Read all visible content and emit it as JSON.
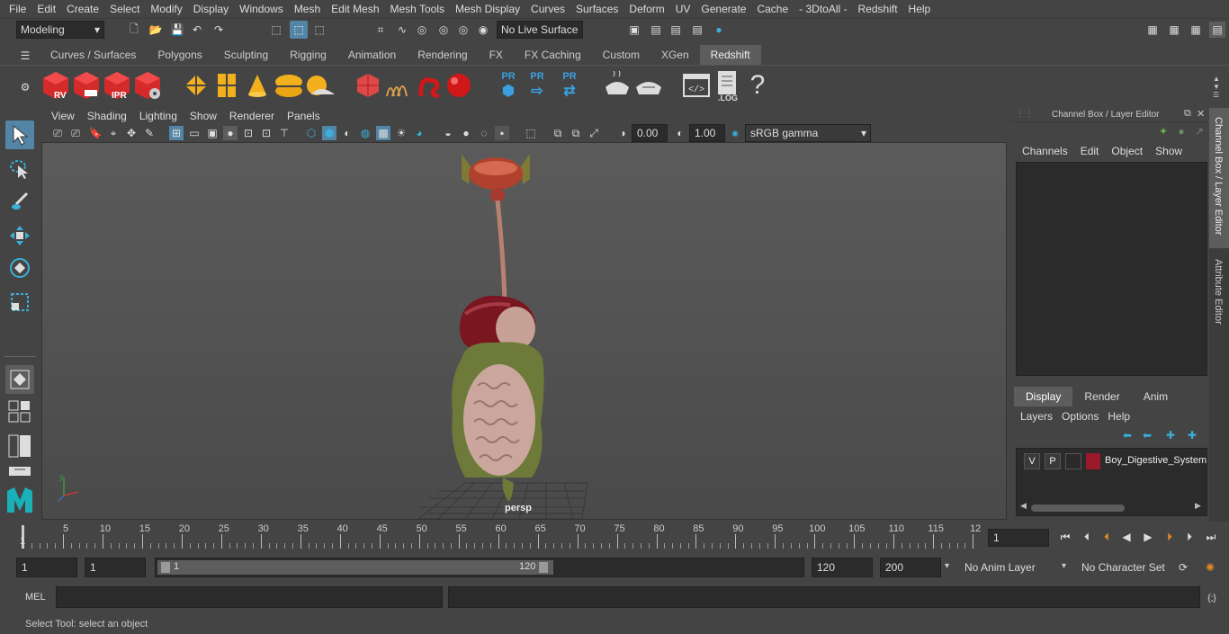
{
  "menu": [
    "File",
    "Edit",
    "Create",
    "Select",
    "Modify",
    "Display",
    "Windows",
    "Mesh",
    "Edit Mesh",
    "Mesh Tools",
    "Mesh Display",
    "Curves",
    "Surfaces",
    "Deform",
    "UV",
    "Generate",
    "Cache",
    "- 3DtoAll -",
    "Redshift",
    "Help"
  ],
  "status": {
    "mode": "Modeling",
    "live_surface": "No Live Surface"
  },
  "shelf_tabs": [
    "Curves / Surfaces",
    "Polygons",
    "Sculpting",
    "Rigging",
    "Animation",
    "Rendering",
    "FX",
    "FX Caching",
    "Custom",
    "XGen",
    "Redshift"
  ],
  "shelf_active": "Redshift",
  "shelf_icons": {
    "rv": "RV",
    "ipr": "IPR",
    "pr": "PR",
    "log": ".LOG",
    "question": "?"
  },
  "viewport": {
    "menu": [
      "View",
      "Shading",
      "Lighting",
      "Show",
      "Renderer",
      "Panels"
    ],
    "exposure": "0.00",
    "gamma": "1.00",
    "color_space": "sRGB gamma",
    "camera_label": "persp"
  },
  "channel_box": {
    "title": "Channel Box / Layer Editor",
    "menu": [
      "Channels",
      "Edit",
      "Object",
      "Show"
    ],
    "layer_tabs": [
      "Display",
      "Render",
      "Anim"
    ],
    "layer_menu": [
      "Layers",
      "Options",
      "Help"
    ],
    "layer": {
      "v": "V",
      "p": "P",
      "name": "Boy_Digestive_System",
      "color": "#9a1a2a"
    }
  },
  "side_tabs": [
    "Channel Box / Layer Editor",
    "Attribute Editor"
  ],
  "timeline": {
    "ticks": [
      "5",
      "10",
      "15",
      "20",
      "25",
      "30",
      "35",
      "40",
      "45",
      "50",
      "55",
      "60",
      "65",
      "70",
      "75",
      "80",
      "85",
      "90",
      "95",
      "100",
      "105",
      "110",
      "115",
      "12"
    ],
    "current_marker": "1",
    "current_frame": "1"
  },
  "range": {
    "start": "1",
    "start2": "1",
    "slider_start": "1",
    "slider_end": "120",
    "end": "120",
    "end2": "200",
    "anim_layer": "No Anim Layer",
    "char_set": "No Character Set"
  },
  "mel": {
    "label": "MEL"
  },
  "help_line": "Select Tool: select an object"
}
